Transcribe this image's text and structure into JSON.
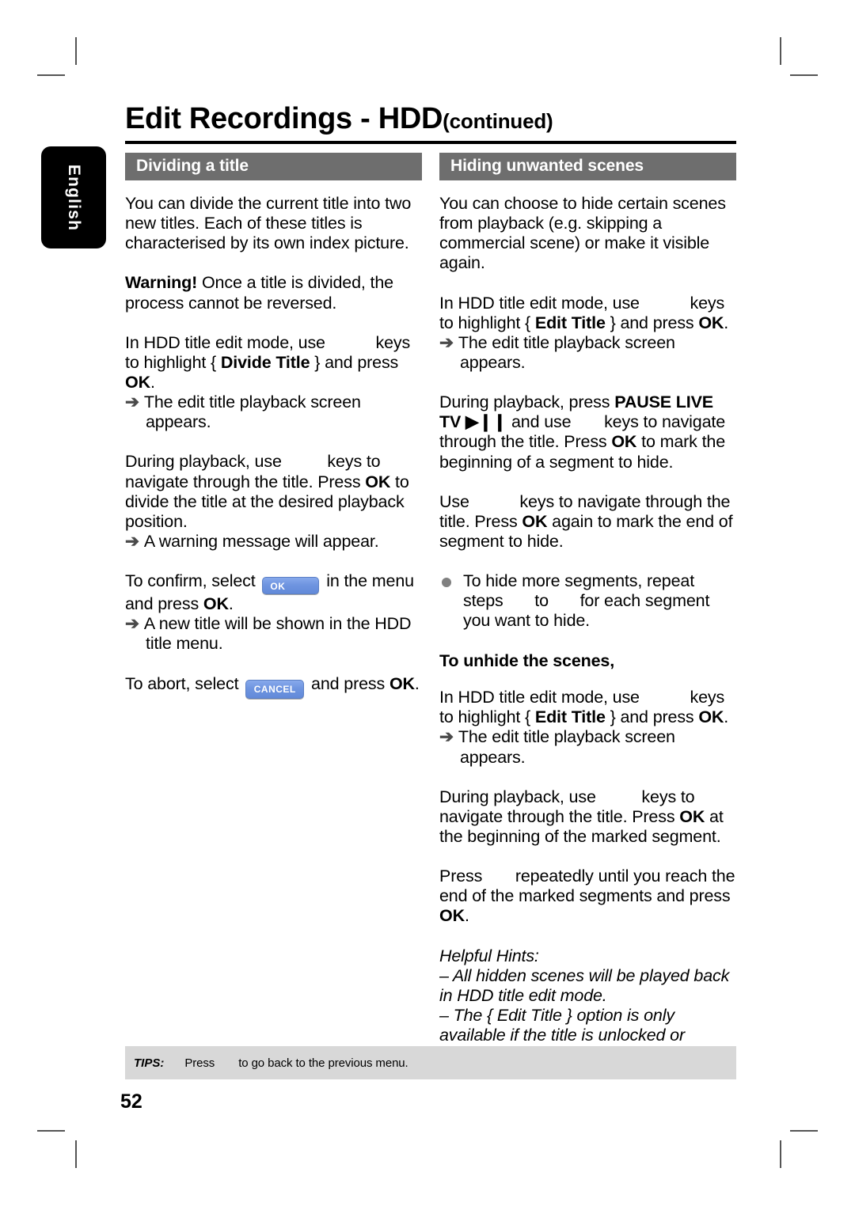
{
  "sidebar": {
    "language_tab": "English"
  },
  "header": {
    "title_main": "Edit Recordings - HDD",
    "title_sub": "(continued)"
  },
  "left_column": {
    "section_title": "Dividing a title",
    "intro": "You can divide the current title into two new titles. Each of these titles is characterised by its own index picture.",
    "warning_label": "Warning!",
    "warning_text": " Once a title is divided, the process cannot be reversed.",
    "step1_a": "In HDD title edit mode, use ",
    "step1_b": " keys to highlight { ",
    "step1_bold": "Divide Title",
    "step1_c": " } and press ",
    "step1_ok": "OK",
    "step1_d": ".",
    "result1": "The edit title playback screen appears.",
    "step2_a": "During playback, use ",
    "step2_b": " keys to navigate through the title. Press ",
    "step2_ok": "OK",
    "step2_c": " to divide the title at the desired playback position.",
    "result2": "A warning message will appear.",
    "step3_a": "To confirm, select ",
    "step3_btn": "OK",
    "step3_b": " in the menu and press ",
    "step3_ok": "OK",
    "step3_c": ".",
    "result3": "A new title will be shown in the HDD title menu.",
    "step4_a": "To abort, select ",
    "step4_btn": "CANCEL",
    "step4_b": " and press ",
    "step4_ok": "OK",
    "step4_c": "."
  },
  "right_column": {
    "section_title": "Hiding unwanted scenes",
    "intro": "You can choose to hide certain scenes from playback (e.g. skipping a commercial scene) or make it visible again.",
    "step1_a": "In HDD title edit mode, use ",
    "step1_b": " keys to highlight { ",
    "step1_bold": "Edit Title",
    "step1_c": " } and press ",
    "step1_ok": "OK",
    "step1_d": ".",
    "result1": "The edit title playback screen appears.",
    "step2_a": "During playback, press ",
    "step2_bold1": "PAUSE LIVE TV",
    "step2_glyph": "▶❙❙",
    "step2_b": " and use ",
    "step2_c": " keys to navigate through the title. Press ",
    "step2_ok": "OK",
    "step2_d": " to mark the beginning of a segment to hide.",
    "step3_a": "Use ",
    "step3_b": " keys to navigate through the title. Press ",
    "step3_ok": "OK",
    "step3_c": " again to mark the end of segment to hide.",
    "bullet_a": "To hide more segments, repeat steps ",
    "bullet_b": " to ",
    "bullet_c": " for each segment you want to hide.",
    "unhide_head": "To unhide the scenes,",
    "unhide_step1_a": "In HDD title edit mode, use ",
    "unhide_step1_b": " keys to highlight { ",
    "unhide_step1_bold": "Edit Title",
    "unhide_step1_c": " } and press ",
    "unhide_step1_ok": "OK",
    "unhide_step1_d": ".",
    "unhide_result1": "The edit title playback screen appears.",
    "unhide_step2_a": "During playback, use ",
    "unhide_step2_b": " keys to navigate through the title. Press ",
    "unhide_step2_ok": "OK",
    "unhide_step2_c": " at the beginning of the marked segment.",
    "unhide_step3_a": "Press ",
    "unhide_step3_b": " repeatedly until you reach the end of the marked segments and press ",
    "unhide_step3_ok": "OK",
    "unhide_step3_c": ".",
    "hints_title": "Helpful Hints:",
    "hint_1": "– All hidden scenes will be played back in HDD title edit mode.",
    "hint_2": "– The { Edit Title } option is only available if the title is unlocked or unprotected."
  },
  "footer": {
    "tips_label": "TIPS:",
    "tips_text_a": "Press",
    "tips_text_b": "to go back to the previous menu.",
    "page_number": "52"
  },
  "icons": {
    "result_arrow": "➔"
  },
  "colors": {
    "section_bar": "#6e6e6e",
    "osd_button": "#6f95e0",
    "tips_bar": "#d8d8d8",
    "language_tab": "#000000",
    "bullet": "#808080"
  }
}
